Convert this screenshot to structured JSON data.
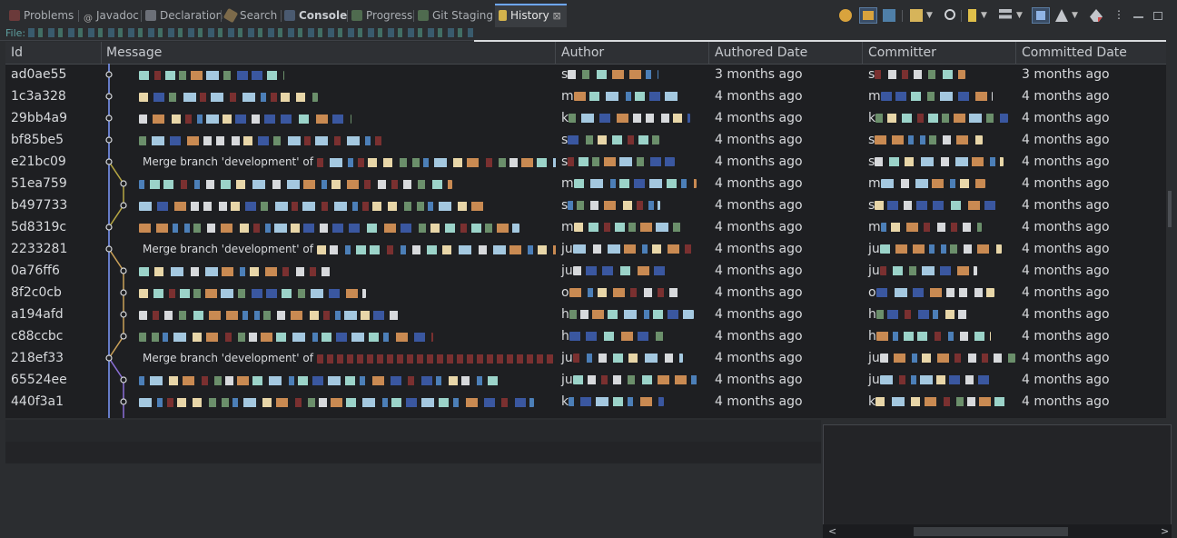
{
  "tabs": [
    {
      "label": "Problems",
      "icon": "problems-icon",
      "active": false
    },
    {
      "label": "Javadoc",
      "icon": "javadoc-icon",
      "active": false
    },
    {
      "label": "Declaration",
      "icon": "declaration-icon",
      "active": false
    },
    {
      "label": "Search",
      "icon": "search-icon",
      "active": false
    },
    {
      "label": "Console",
      "icon": "console-icon",
      "active": false
    },
    {
      "label": "Progress",
      "icon": "progress-icon",
      "active": false
    },
    {
      "label": "Git Staging",
      "icon": "git-staging-icon",
      "active": false
    },
    {
      "label": "History",
      "icon": "history-icon",
      "active": true,
      "close": "⊠"
    }
  ],
  "file_label": "File:",
  "columns": [
    "Id",
    "Message",
    "Author",
    "Authored Date",
    "Committer",
    "Committed Date"
  ],
  "commits": [
    {
      "id": "ad0ae55",
      "merge": false,
      "message": "",
      "author": "s",
      "authored": "3 months ago",
      "committer": "s",
      "committed": "3 months ago"
    },
    {
      "id": "1c3a328",
      "merge": false,
      "message": "",
      "author": "m",
      "authored": "4 months ago",
      "committer": "m",
      "committed": "4 months ago"
    },
    {
      "id": "29bb4a9",
      "merge": false,
      "message": "",
      "author": "k",
      "authored": "4 months ago",
      "committer": "k",
      "committed": "4 months ago"
    },
    {
      "id": "bf85be5",
      "merge": false,
      "message": "",
      "author": "s",
      "authored": "4 months ago",
      "committer": "s",
      "committed": "4 months ago"
    },
    {
      "id": "e21bc09",
      "merge": true,
      "message": "Merge branch 'development' of",
      "author": "s",
      "authored": "4 months ago",
      "committer": "s",
      "committed": "4 months ago"
    },
    {
      "id": "51ea759",
      "merge": false,
      "message": "",
      "author": "m",
      "authored": "4 months ago",
      "committer": "m",
      "committed": "4 months ago"
    },
    {
      "id": "b497733",
      "merge": false,
      "message": "",
      "author": "s",
      "authored": "4 months ago",
      "committer": "s",
      "committed": "4 months ago"
    },
    {
      "id": "5d8319c",
      "merge": false,
      "message": "",
      "author": "m",
      "authored": "4 months ago",
      "committer": "m",
      "committed": "4 months ago"
    },
    {
      "id": "2233281",
      "merge": true,
      "message": "Merge branch 'development' of",
      "author": "ju",
      "authored": "4 months ago",
      "committer": "ju",
      "committed": "4 months ago"
    },
    {
      "id": "0a76ff6",
      "merge": false,
      "message": "",
      "author": "ju",
      "authored": "4 months ago",
      "committer": "ju",
      "committed": "4 months ago"
    },
    {
      "id": "8f2c0cb",
      "merge": false,
      "message": "",
      "author": "o",
      "authored": "4 months ago",
      "committer": "o",
      "committed": "4 months ago"
    },
    {
      "id": "a194afd",
      "merge": false,
      "message": "",
      "author": "h",
      "authored": "4 months ago",
      "committer": "h",
      "committed": "4 months ago"
    },
    {
      "id": "c88ccbc",
      "merge": false,
      "message": "",
      "author": "h",
      "authored": "4 months ago",
      "committer": "h",
      "committed": "4 months ago"
    },
    {
      "id": "218ef33",
      "merge": true,
      "message": "Merge branch 'development' of",
      "author": "ju",
      "authored": "4 months ago",
      "committer": "ju",
      "committed": "4 months ago"
    },
    {
      "id": "65524ee",
      "merge": false,
      "message": "",
      "author": "ju",
      "authored": "4 months ago",
      "committer": "ju",
      "committed": "4 months ago"
    },
    {
      "id": "440f3a1",
      "merge": false,
      "message": "",
      "author": "k",
      "authored": "4 months ago",
      "committer": "k",
      "committed": "4 months ago"
    }
  ],
  "scroll_arrows": {
    "left": "<",
    "right": ">"
  },
  "colors": {
    "accent": "#6ea7ff",
    "graph_blue": "#7f9cff",
    "graph_yellow": "#b5a642",
    "graph_orange": "#c9a058",
    "graph_violet": "#8a6fd6"
  }
}
